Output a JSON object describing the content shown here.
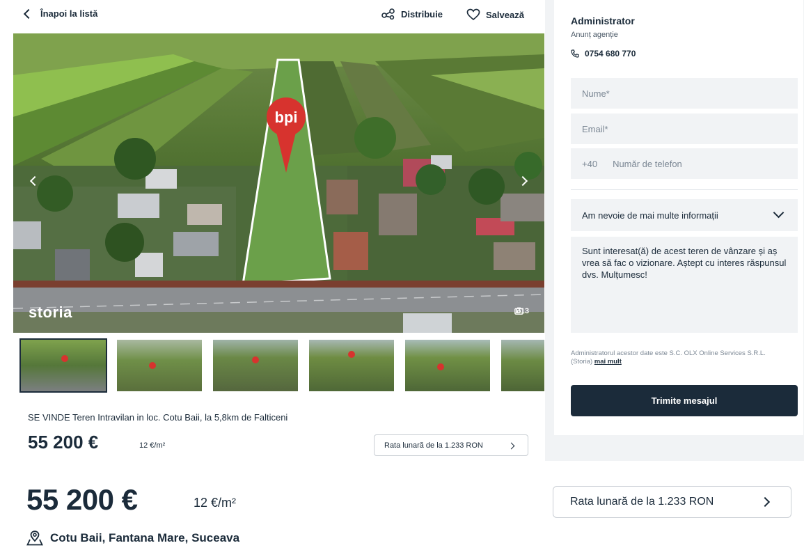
{
  "topbar": {
    "back_label": "Înapoi la listă",
    "share_label": "Distribuie",
    "save_label": "Salvează"
  },
  "gallery": {
    "watermark": "storia",
    "counter": "1/13",
    "thumbnail_count": 6
  },
  "listing": {
    "title": "SE VINDE Teren Intravilan in loc. Cotu Baii, la 5,8km de Falticeni",
    "price": "55 200 €",
    "price_per_sqm": "12 €/m²",
    "monthly_rate": "Rata lunară de la 1.233 RON",
    "location": "Cotu Baii, Fantana Mare, Suceava"
  },
  "contact": {
    "name": "Administrator",
    "type": "Anunț agenție",
    "phone": "0754 680 770",
    "name_placeholder": "Nume*",
    "email_placeholder": "Email*",
    "phone_prefix": "+40",
    "phone_placeholder": "Număr de telefon",
    "info_select": "Am nevoie de mai multe informații",
    "message": "Sunt interesat(ă) de acest teren de vânzare și aș vrea să fac o vizionare. Aștept cu interes răspunsul dvs. Mulțumesc!",
    "disclaimer": "Administratorul acestor date este S.C. OLX Online Services S.R.L. (Storia)",
    "disclaimer_link": "mai mult",
    "send_label": "Trimite mesajul"
  },
  "colors": {
    "navy": "#1b2b3a",
    "field_bg": "#f1f3f5",
    "pin_red": "#d7332e"
  }
}
